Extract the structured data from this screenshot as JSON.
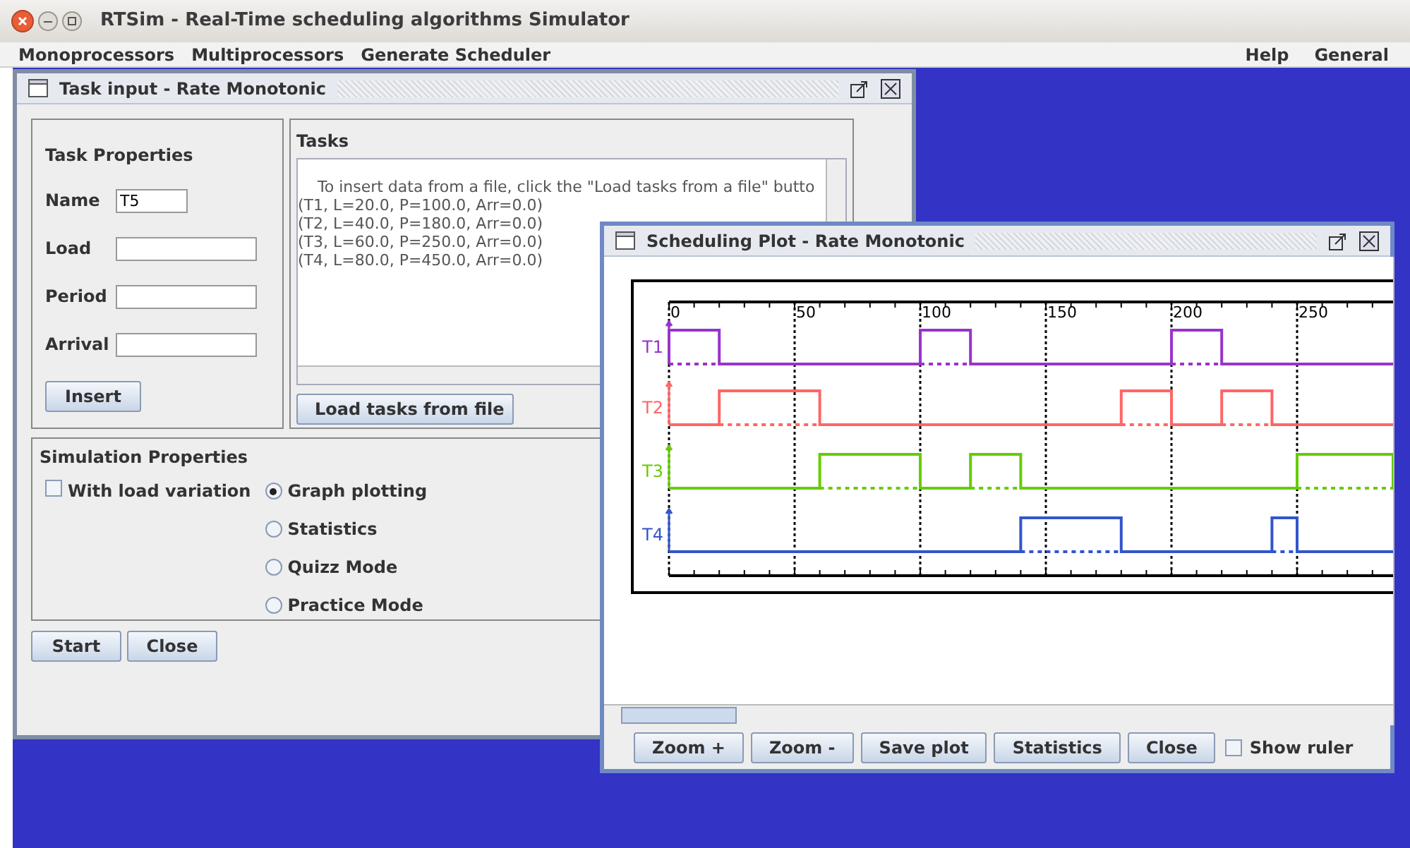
{
  "app": {
    "title": "RTSim - Real-Time scheduling algorithms Simulator"
  },
  "menu": {
    "left": [
      "Monoprocessors",
      "Multiprocessors",
      "Generate Scheduler"
    ],
    "right": [
      "Help",
      "General"
    ]
  },
  "task_input": {
    "title": "Task input - Rate Monotonic",
    "properties_title": "Task Properties",
    "fields": [
      {
        "label": "Name",
        "value": "T5"
      },
      {
        "label": "Load"
      },
      {
        "label": "Period"
      },
      {
        "label": "Arrival"
      }
    ],
    "insert_button": "Insert",
    "tasks_title": "Tasks",
    "tasks_intro": "To insert data from a file, click the \"Load tasks from a file\" butto",
    "tasks_lines": [
      "(T1, L=20.0, P=100.0, Arr=0.0)",
      "(T2, L=40.0, P=180.0, Arr=0.0)",
      "(T3, L=60.0, P=250.0, Arr=0.0)",
      "(T4, L=80.0, P=450.0, Arr=0.0)"
    ],
    "load_button": "Load tasks from file",
    "simulation_title": "Simulation Properties",
    "load_variation": {
      "label": "With load variation",
      "checked": false
    },
    "modes": [
      {
        "label": "Graph plotting",
        "selected": true
      },
      {
        "label": "Statistics",
        "selected": false
      },
      {
        "label": "Quizz Mode",
        "selected": false
      },
      {
        "label": "Practice Mode",
        "selected": false
      }
    ],
    "buttons": [
      "Start",
      "Close"
    ]
  },
  "plot_window": {
    "title": "Scheduling Plot - Rate Monotonic",
    "timeline": {
      "ticks": [
        "0",
        "50",
        "100",
        "150",
        "200",
        "250"
      ],
      "tasks": [
        {
          "label": "T1",
          "color": "#9933cc"
        },
        {
          "label": "T2",
          "color": "#ff6666"
        },
        {
          "label": "T3",
          "color": "#66cc00"
        },
        {
          "label": "T4",
          "color": "#3355cc"
        }
      ]
    },
    "buttons": [
      "Zoom +",
      "Zoom -",
      "Save plot",
      "Statistics",
      "Close"
    ],
    "show_ruler": {
      "label": "Show ruler",
      "checked": false
    }
  }
}
